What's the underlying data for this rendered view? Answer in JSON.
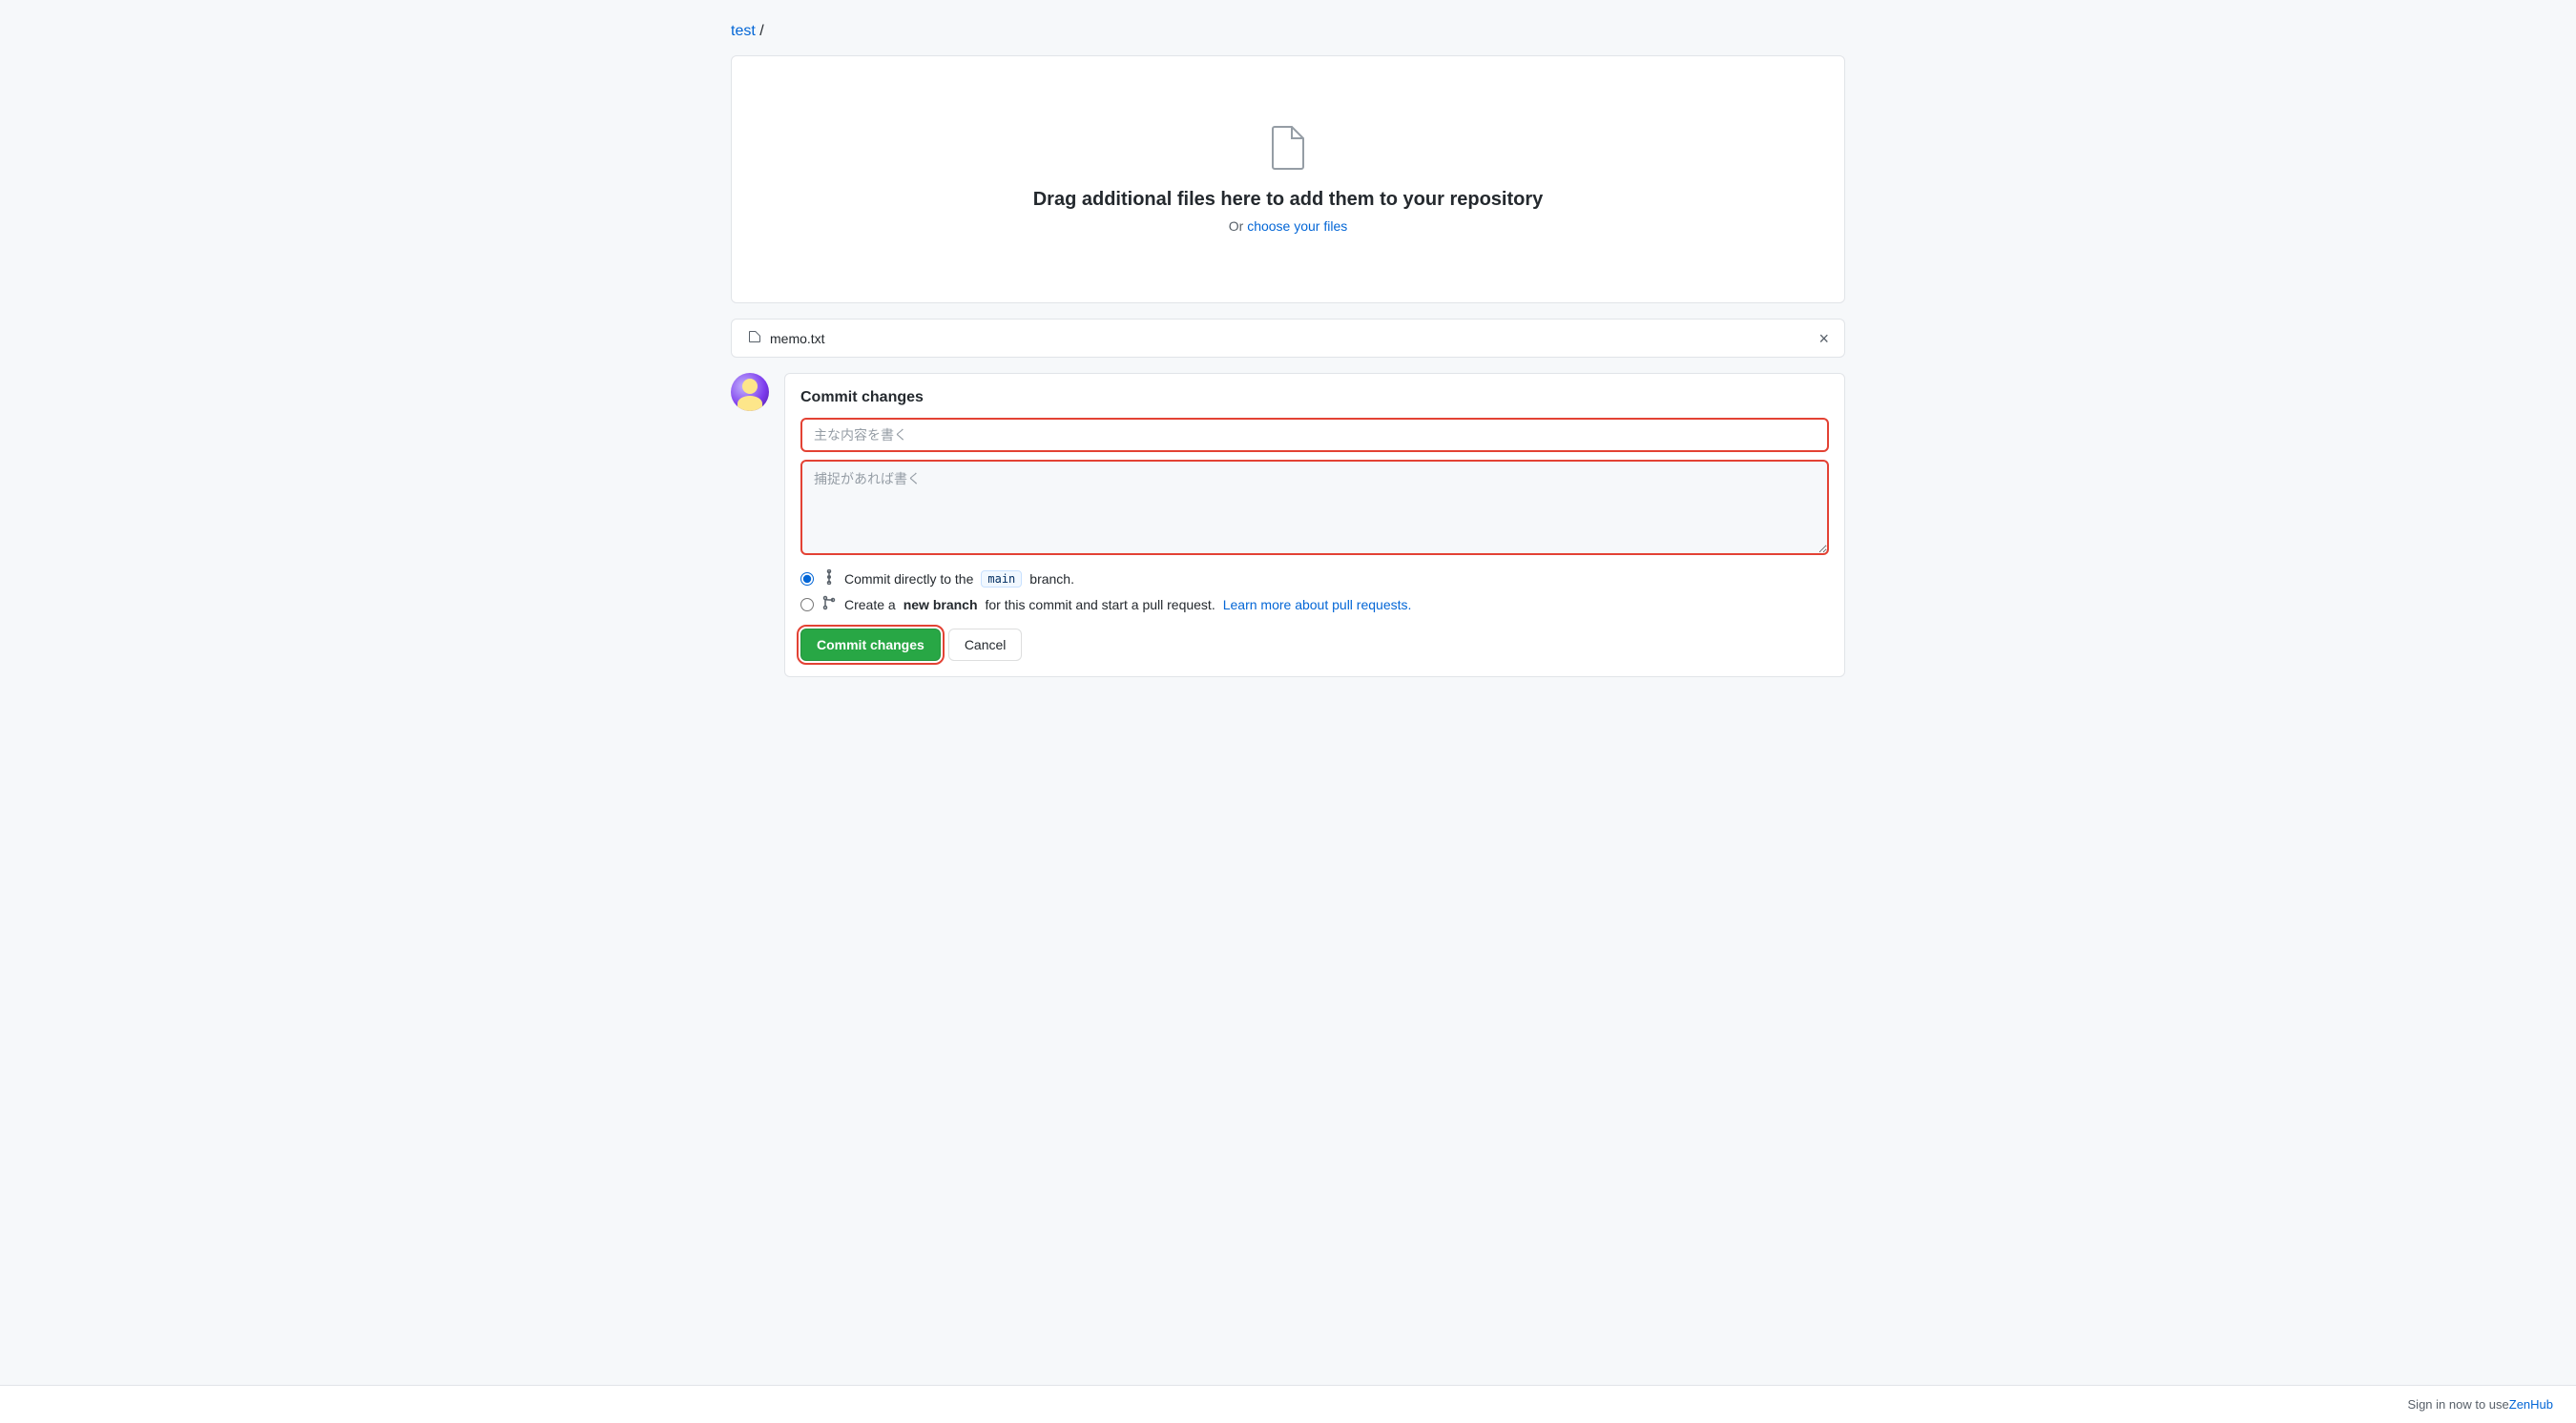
{
  "breadcrumb": {
    "repo_link_text": "test",
    "separator": "/"
  },
  "drop_zone": {
    "drag_text": "Drag additional files here to add them to your repository",
    "or_text": "Or",
    "choose_files_text": "choose your files"
  },
  "file_bar": {
    "filename": "memo.txt",
    "close_icon": "×"
  },
  "commit_section": {
    "title": "Commit changes",
    "summary_placeholder": "主な内容を書く",
    "description_placeholder": "捕捉があれば書く",
    "radio_option_1_prefix": "Commit directly to the",
    "branch_name": "main",
    "radio_option_1_suffix": "branch.",
    "radio_option_2_prefix": "Create a",
    "radio_option_2_bold": "new branch",
    "radio_option_2_suffix": "for this commit and start a pull request.",
    "learn_more_text": "Learn more about pull requests.",
    "commit_button_label": "Commit changes",
    "cancel_button_label": "Cancel"
  },
  "bottom_bar": {
    "text": "Sign in now to use ZenHub"
  }
}
